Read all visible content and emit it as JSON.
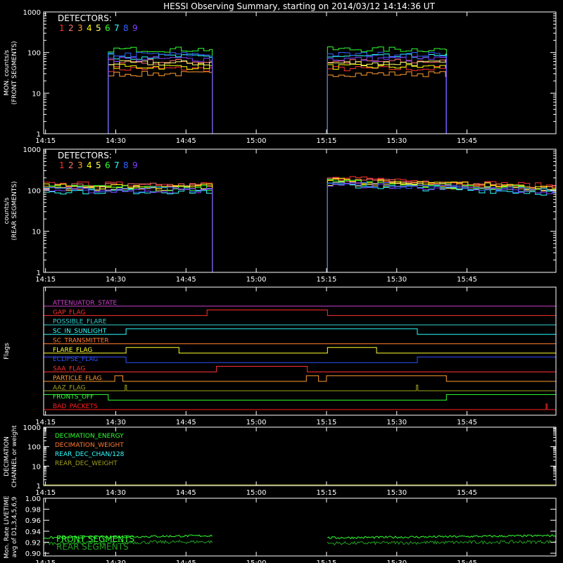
{
  "title": "HESSI Observing Summary, starting on 2014/03/12 14:14:36 UT",
  "colors": {
    "axis": "#ffffff",
    "detectors": [
      "#ff3030",
      "#ff7070",
      "#ff9a30",
      "#ffff00",
      "#ffff70",
      "#30ff30",
      "#30ffff",
      "#3060ff",
      "#8040ff"
    ]
  },
  "time_ticks": [
    "14:15",
    "14:30",
    "14:45",
    "15:00",
    "15:15",
    "15:30",
    "15:45"
  ],
  "time_tick_minutes": [
    15,
    30,
    45,
    60,
    75,
    90,
    105
  ],
  "time_range_minutes": [
    14.6,
    124
  ],
  "chart_data": [
    {
      "type": "line",
      "panel": "front",
      "ylabel": "MON. counts/s\n(FRONT SEGMENTS)",
      "yscale": "log",
      "ylim": [
        1,
        1000
      ],
      "yticks": [
        "1",
        "10",
        "100",
        "1000"
      ],
      "legend_title": "DETECTORS:",
      "detector_labels": [
        "1",
        "2",
        "3",
        "4",
        "5",
        "6",
        "7",
        "8",
        "9"
      ],
      "on_intervals_minutes": [
        [
          28.4,
          50.6
        ],
        [
          75.2,
          100.6
        ]
      ],
      "level_by_detector": [
        40,
        60,
        30,
        45,
        55,
        120,
        80,
        90,
        70
      ]
    },
    {
      "type": "line",
      "panel": "rear",
      "ylabel": "counts/s\n(REAR SEGMENTS)",
      "yscale": "log",
      "ylim": [
        1,
        1000
      ],
      "yticks": [
        "1",
        "10",
        "100",
        "1000"
      ],
      "legend_title": "DETECTORS:",
      "detector_labels": [
        "1",
        "2",
        "3",
        "4",
        "5",
        "6",
        "7",
        "8",
        "9"
      ],
      "on_intervals_minutes": [
        [
          14.6,
          50.6
        ],
        [
          75.2,
          124
        ]
      ],
      "level_by_detector": [
        140,
        130,
        120,
        125,
        110,
        115,
        95,
        105,
        100
      ]
    },
    {
      "type": "line",
      "panel": "flags",
      "ylabel": "Flags",
      "flags": [
        {
          "name": "ATTENUATOR_STATE",
          "color": "#d040d0",
          "high": []
        },
        {
          "name": "GAP_FLAG",
          "color": "#ff3030",
          "high": [
            [
              49.5,
              75.2
            ]
          ]
        },
        {
          "name": "POSSIBLE_FLARE",
          "color": "#30d0d0",
          "high": []
        },
        {
          "name": "SC_IN_SUNLIGHT",
          "color": "#30ffff",
          "high": [
            [
              32.2,
              94.4
            ]
          ]
        },
        {
          "name": "SC_TRANSMITTER",
          "color": "#ff7a30",
          "high": []
        },
        {
          "name": "FLARE_FLAG",
          "color": "#ffff30",
          "high": [
            [
              32.2,
              43.5
            ],
            [
              75.2,
              85.7
            ]
          ]
        },
        {
          "name": "ECLIPSE_FLAG",
          "color": "#3050ff",
          "high": [
            [
              14.6,
              32.2
            ],
            [
              94.4,
              124
            ]
          ]
        },
        {
          "name": "SAA_FLAG",
          "color": "#ff3030",
          "high": [
            [
              51.5,
              70.9
            ]
          ]
        },
        {
          "name": "PARTICLE_FLAG",
          "color": "#ff9a30",
          "high": [
            [
              29.8,
              31.5
            ],
            [
              70.7,
              73.3
            ],
            [
              75.0,
              100.6
            ]
          ]
        },
        {
          "name": "AAZ_FLAG",
          "color": "#a0a020",
          "high": [
            [
              32.0,
              32.3
            ],
            [
              94.2,
              94.5
            ]
          ]
        },
        {
          "name": "FRONTS_OFF",
          "color": "#30ff30",
          "high": [
            [
              14.6,
              28.4
            ],
            [
              100.6,
              124
            ]
          ]
        },
        {
          "name": "BAD_PACKETS",
          "color": "#ff2020",
          "high": [
            [
              121.9,
              122.1
            ]
          ]
        }
      ]
    },
    {
      "type": "line",
      "panel": "decimation",
      "ylabel": "DECIMATION\nCHANNEL or weight",
      "yscale": "log",
      "ylim": [
        1,
        1000
      ],
      "yticks": [
        "1",
        "10",
        "100",
        "1000"
      ],
      "legend": [
        {
          "name": "DECIMATION_ENERGY",
          "color": "#30ff30"
        },
        {
          "name": "DECIMATION_WEIGHT",
          "color": "#ff7a30"
        },
        {
          "name": "REAR_DEC_CHAN/128",
          "color": "#30ffff"
        },
        {
          "name": "REAR_DEC_WEIGHT",
          "color": "#a0a020"
        }
      ]
    },
    {
      "type": "line",
      "panel": "livetime",
      "ylabel": "Mon. Rate LIVETIME\navg of D1,3,4,5,6,9",
      "ylim": [
        0.895,
        1.0
      ],
      "yticks": [
        "0.90",
        "0.92",
        "0.94",
        "0.96",
        "0.98",
        "1.00"
      ],
      "ytick_values": [
        0.9,
        0.92,
        0.94,
        0.96,
        0.98,
        1.0
      ],
      "legend": [
        {
          "name": "FRONT SEGMENTS",
          "color": "#30ff30"
        },
        {
          "name": "REAR SEGMENTS",
          "color": "#20a020"
        }
      ],
      "front_level": 0.928,
      "rear_level": 0.918,
      "on_intervals_minutes": [
        [
          14.6,
          50.6
        ],
        [
          75.2,
          124
        ]
      ]
    }
  ]
}
